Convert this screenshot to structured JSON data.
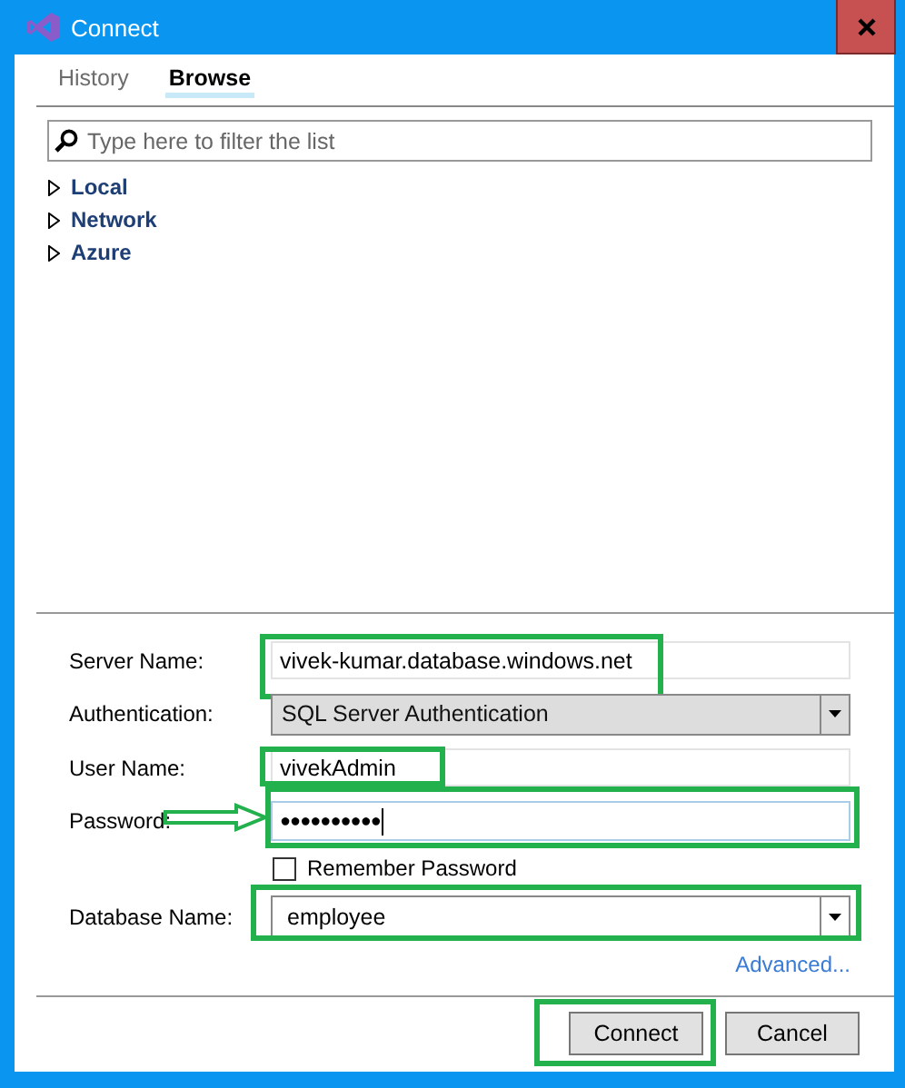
{
  "window": {
    "title": "Connect"
  },
  "tabs": [
    {
      "label": "History",
      "selected": false
    },
    {
      "label": "Browse",
      "selected": true
    }
  ],
  "filter": {
    "placeholder": "Type here to filter the list"
  },
  "tree": [
    {
      "label": "Local",
      "expanded": false
    },
    {
      "label": "Network",
      "expanded": false
    },
    {
      "label": "Azure",
      "expanded": false
    }
  ],
  "form": [
    {
      "kind": "text",
      "label": "Server Name:",
      "value": "vivek-kumar.database.windows.net",
      "highlighted": true
    },
    {
      "kind": "dropdown",
      "label": "Authentication:",
      "value": "SQL Server Authentication",
      "disabled": true,
      "highlighted": false
    },
    {
      "kind": "text",
      "label": "User Name:",
      "value": "vivekAdmin",
      "highlighted": true
    },
    {
      "kind": "password",
      "label": "Password:",
      "value": "●●●●●●●●●●",
      "highlighted": true,
      "pointed": true
    },
    {
      "kind": "checkbox",
      "label": "Remember Password",
      "checked": false
    },
    {
      "kind": "dropdown",
      "label": "Database Name:",
      "value": "employee",
      "disabled": false,
      "highlighted": true
    }
  ],
  "advanced_link": "Advanced...",
  "buttons": [
    {
      "label": "Connect",
      "highlighted": true
    },
    {
      "label": "Cancel",
      "highlighted": false
    }
  ]
}
